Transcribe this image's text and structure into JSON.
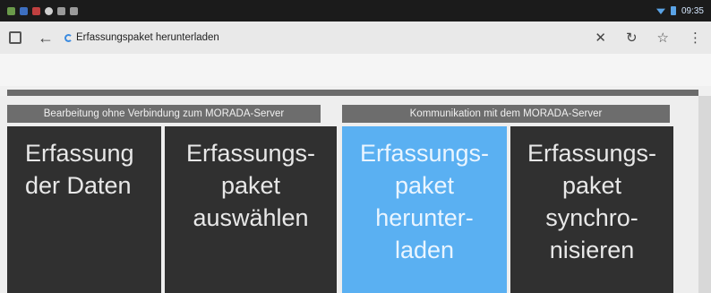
{
  "status_bar": {
    "time": "09:35"
  },
  "browser": {
    "url_text": "Erfassungspaket herunterladen",
    "icons": [
      "tabs-icon",
      "back-arrow-icon",
      "loading-icon",
      "close-icon",
      "reload-icon",
      "star-icon",
      "menu-icon"
    ]
  },
  "sections": {
    "offline": "Bearbeitung ohne Verbindung zum MORADA-Server",
    "online": "Kommunikation mit dem MORADA-Server"
  },
  "tiles": [
    {
      "label": "Erfassung\nder Daten",
      "active": false
    },
    {
      "label": "Erfassungs-\npaket\nauswählen",
      "active": false
    },
    {
      "label": "Erfassungs-\npaket\nherunter-\nladen",
      "active": true
    },
    {
      "label": "Erfassungs-\npaket\nsynchro-\nnisieren",
      "active": false
    }
  ],
  "colors": {
    "active_tile": "#5ab0f2",
    "tile": "#303030",
    "section_header": "#6d6d6d"
  }
}
